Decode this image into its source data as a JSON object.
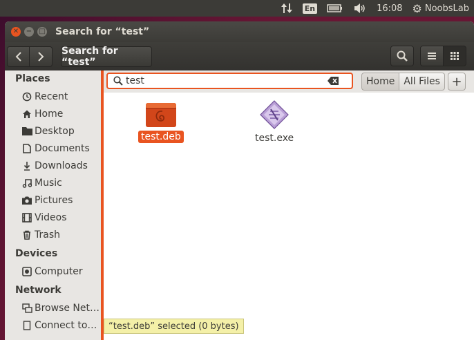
{
  "top_panel": {
    "lang": "En",
    "time": "16:08",
    "user": "NoobsLab",
    "icons": [
      "network-transfer-icon",
      "battery-icon",
      "volume-icon",
      "settings-gear-icon"
    ]
  },
  "window": {
    "title": "Search for “test”",
    "path_button": "Search for “test”"
  },
  "search": {
    "value": "test"
  },
  "location_buttons": {
    "home": "Home",
    "all_files": "All Files",
    "add": "+"
  },
  "sidebar": {
    "places_header": "Places",
    "places": [
      {
        "label": "Recent",
        "icon": "recent-icon"
      },
      {
        "label": "Home",
        "icon": "home-icon"
      },
      {
        "label": "Desktop",
        "icon": "desktop-folder-icon"
      },
      {
        "label": "Documents",
        "icon": "documents-icon"
      },
      {
        "label": "Downloads",
        "icon": "downloads-icon"
      },
      {
        "label": "Music",
        "icon": "music-icon"
      },
      {
        "label": "Pictures",
        "icon": "pictures-icon"
      },
      {
        "label": "Videos",
        "icon": "videos-icon"
      },
      {
        "label": "Trash",
        "icon": "trash-icon"
      }
    ],
    "devices_header": "Devices",
    "devices": [
      {
        "label": "Computer",
        "icon": "computer-icon"
      }
    ],
    "network_header": "Network",
    "network": [
      {
        "label": "Browse Net…",
        "icon": "network-icon"
      },
      {
        "label": "Connect to…",
        "icon": "connect-icon"
      }
    ]
  },
  "files": [
    {
      "name": "test.deb",
      "icon": "debian-package-icon",
      "selected": true
    },
    {
      "name": "test.exe",
      "icon": "executable-icon",
      "selected": false
    }
  ],
  "status": "“test.deb” selected  (0 bytes)",
  "colors": {
    "accent": "#e95420",
    "titlebar": "#3c3b37",
    "sidebar_bg": "#e8e6e3"
  }
}
